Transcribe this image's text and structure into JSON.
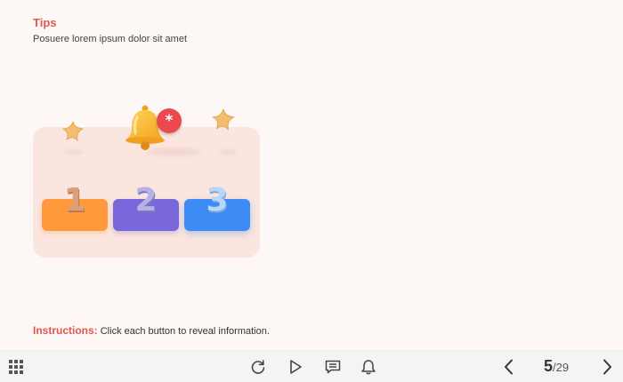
{
  "slide": {
    "title": "Tips",
    "subtitle": "Posuere lorem ipsum dolor sit amet",
    "buttons": [
      {
        "label": "1",
        "color": "#ff9a3c"
      },
      {
        "label": "2",
        "color": "#7a67d9"
      },
      {
        "label": "3",
        "color": "#3d8bf5"
      }
    ],
    "bell_badge": "*",
    "instructions_label": "Instructions:",
    "instructions_text": "Click each button to reveal information."
  },
  "toolbar": {
    "icons": [
      "grid-menu-icon",
      "replay-icon",
      "play-icon",
      "comment-icon",
      "bell-icon",
      "prev-icon",
      "next-icon"
    ],
    "current_page": "5",
    "total_pages": "/29"
  },
  "colors": {
    "accent": "#e0574f",
    "background": "#fdf7f5",
    "card": "#fbe6df",
    "toolbar": "#f4f4f4"
  }
}
